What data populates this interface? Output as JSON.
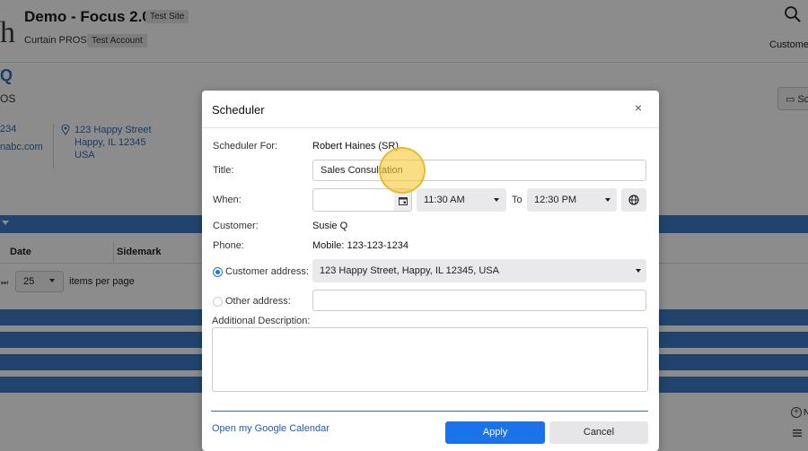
{
  "app": {
    "title": "Demo - Focus 2.0",
    "site_badge": "Test Site",
    "company": "Curtain PROS",
    "account_badge": "Test Account",
    "logo_char": "h",
    "customer_nav": "Custome"
  },
  "background": {
    "q_char": "Q",
    "os_text": "OS",
    "schedule_btn": "Sc",
    "phone_partial": "234",
    "email_partial": "nabc.com",
    "address_lines": [
      "123 Happy Street",
      "Happy, IL 12345",
      "USA"
    ],
    "table": {
      "col_date": "Date",
      "col_sidemark": "Sidemark"
    },
    "pager": {
      "per_page_value": "25",
      "per_page_label": "items per page"
    },
    "add_text": "N"
  },
  "modal": {
    "title": "Scheduler",
    "close": "×",
    "scheduler_for_label": "Scheduler For:",
    "scheduler_for_value": "Robert Haines (SR)",
    "title_label": "Title:",
    "title_value": "Sales Consultation",
    "when_label": "When:",
    "date_value": "",
    "start_time": "11:30 AM",
    "to_label": "To",
    "end_time": "12:30 PM",
    "customer_label": "Customer:",
    "customer_value": "Susie Q",
    "phone_label": "Phone:",
    "phone_value": "Mobile: 123-123-1234",
    "customer_address_label": "Customer address:",
    "customer_address_value": "123 Happy Street, Happy, IL 12345, USA",
    "other_address_label": "Other address:",
    "other_address_value": "",
    "additional_desc_label": "Additional Description:",
    "google_calendar_link": "Open my Google Calendar",
    "apply": "Apply",
    "cancel": "Cancel"
  },
  "colors": {
    "primary": "#1a73e8",
    "band": "#3d7cc9",
    "link": "#2c6fb7"
  }
}
